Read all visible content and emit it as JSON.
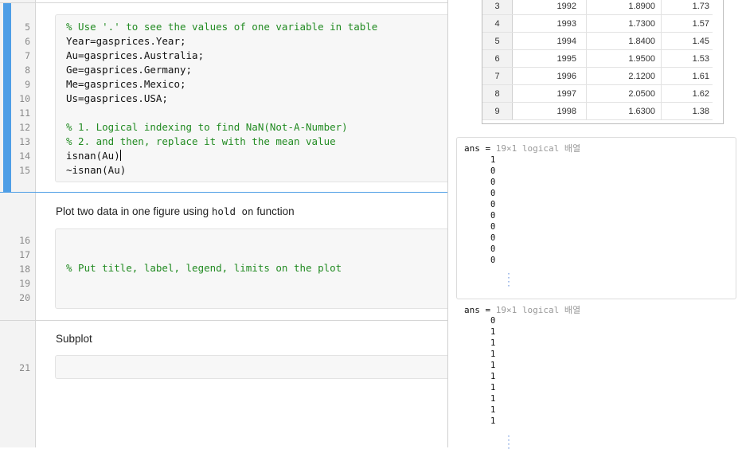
{
  "editor": {
    "line_numbers": {
      "block1": [
        "5",
        "6",
        "7",
        "8",
        "9",
        "10",
        "11",
        "12",
        "13",
        "14",
        "15"
      ],
      "block2": [
        "16",
        "17",
        "18",
        "19",
        "20"
      ],
      "block3": [
        "21"
      ]
    },
    "code_block1": [
      "% Use '.' to see the values of one variable in table",
      "Year=gasprices.Year;",
      "Au=gasprices.Australia;",
      "Ge=gasprices.Germany;",
      "Me=gasprices.Mexico;",
      "Us=gasprices.USA;",
      "",
      "% 1. Logical indexing to find NaN(Not-A-Number)",
      "% 2. and then, replace it with the mean value",
      "isnan(Au)",
      "~isnan(Au)"
    ],
    "text_cell1": {
      "before": "Plot two data in one figure using ",
      "code": "hold on",
      "after": " function"
    },
    "code_block2_comment": "% Put title, label, legend, limits on the plot",
    "text_cell2": "Subplot"
  },
  "output": {
    "table_rows": [
      {
        "row": "3",
        "year": "1992",
        "v1": "1.8900",
        "v2": "1.73"
      },
      {
        "row": "4",
        "year": "1993",
        "v1": "1.7300",
        "v2": "1.57"
      },
      {
        "row": "5",
        "year": "1994",
        "v1": "1.8400",
        "v2": "1.45"
      },
      {
        "row": "6",
        "year": "1995",
        "v1": "1.9500",
        "v2": "1.53"
      },
      {
        "row": "7",
        "year": "1996",
        "v1": "2.1200",
        "v2": "1.61"
      },
      {
        "row": "8",
        "year": "1997",
        "v1": "2.0500",
        "v2": "1.62"
      },
      {
        "row": "9",
        "year": "1998",
        "v1": "1.6300",
        "v2": "1.38"
      }
    ],
    "ans1": {
      "label": "ans = ",
      "type": "19×1 logical 배열",
      "values": [
        "1",
        "0",
        "0",
        "0",
        "0",
        "0",
        "0",
        "0",
        "0",
        "0"
      ]
    },
    "ans2": {
      "label": "ans = ",
      "type": "19×1 logical 배열",
      "values": [
        "0",
        "1",
        "1",
        "1",
        "1",
        "1",
        "1",
        "1",
        "1",
        "1"
      ]
    }
  }
}
